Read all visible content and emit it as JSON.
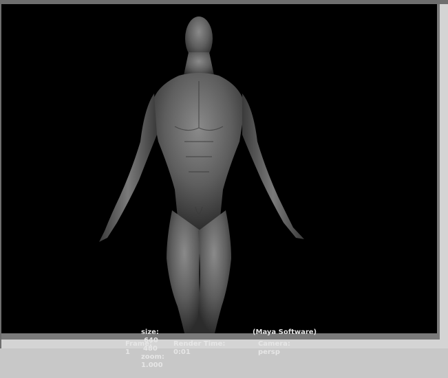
{
  "render_info": {
    "size_label": "size:",
    "width": "640",
    "height": "480",
    "zoom_label": "zoom:",
    "zoom": "1.000",
    "renderer": "(Maya Software)",
    "frame_label": "Frame:",
    "frame": "1",
    "render_time_label": "Render Time:",
    "render_time": "0:01",
    "camera_label": "Camera:",
    "camera": "persp"
  },
  "colors": {
    "viewport_background": "#000000",
    "figure_shade": "#6a6a6a",
    "info_text": "#e6e6e6",
    "frame_gray": "#7a7a7a"
  }
}
